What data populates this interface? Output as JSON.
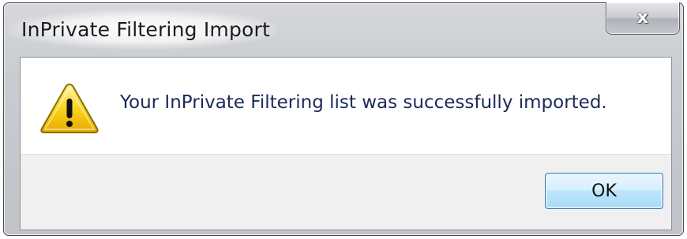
{
  "window": {
    "title": "InPrivate Filtering Import",
    "close_glyph": "x"
  },
  "dialog": {
    "icon": "warning-icon",
    "message": "Your InPrivate Filtering list was successfully imported."
  },
  "buttons": {
    "ok_label": "OK"
  },
  "colors": {
    "message_text": "#1a2a5a",
    "ok_border": "#3c7fb1",
    "warning_fill": "#f5c400",
    "warning_outline": "#8a6f00"
  }
}
